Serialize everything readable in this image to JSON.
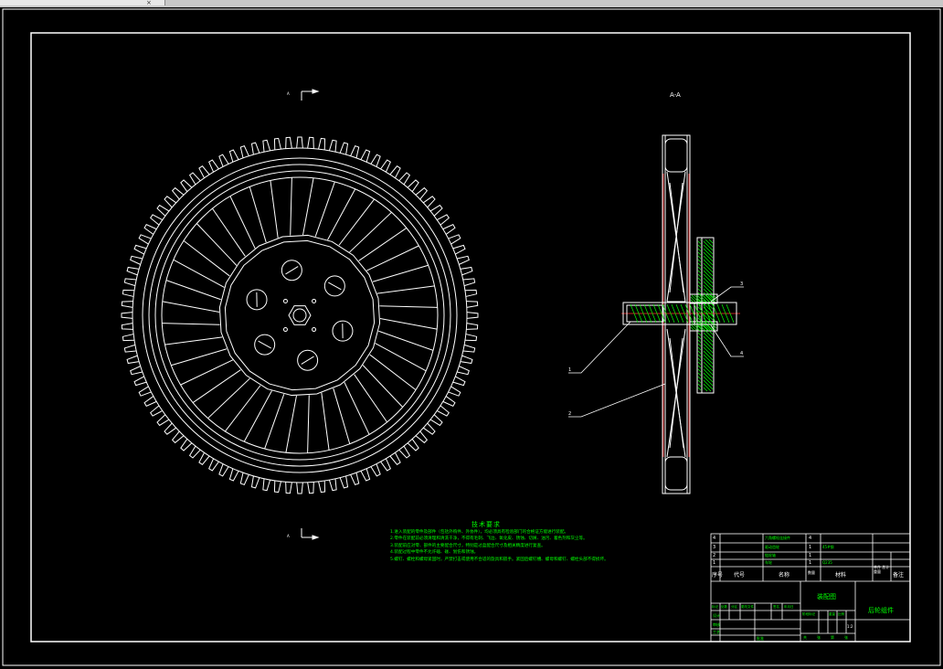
{
  "window": {
    "tab_close_glyph": "×"
  },
  "drawing": {
    "section_mark_top": "A",
    "section_mark_bottom": "A",
    "section_view_label": "A-A",
    "part_callouts": [
      "1",
      "2",
      "3",
      "4"
    ]
  },
  "notes": {
    "title": "技术要求",
    "lines": [
      "1.进入装配的零件及部件（包括外购件、外协件），均必须具有检验部门的合格证方能进行装配。",
      "2.零件在装配前必须清理和清洗干净，不得有毛刺、飞边、氧化皮、锈蚀、切屑、油污、着色剂和灰尘等。",
      "3.装配前应对零、部件的主要配合尺寸，特别是过盈配合尺寸及相关精度进行复查。",
      "4.装配过程中零件不允许磕、碰、划伤和锈蚀。",
      "5.螺钉、螺栓和螺母紧固时，严禁打击或使用不合适的旋具和扳手。紧固后螺钉槽、螺母和螺钉、螺栓头部不得损坏。"
    ]
  },
  "title_block": {
    "bom_rows": [
      {
        "no": "4",
        "name": "六角螺栓连接件",
        "qty": "4",
        "material": ""
      },
      {
        "no": "3",
        "name": "驱动齿轮",
        "qty": "1",
        "material": "45#钢"
      },
      {
        "no": "2",
        "name": "链轮轴",
        "qty": "1",
        "material": ""
      },
      {
        "no": "1",
        "name": "车轮",
        "qty": "1",
        "material": "Q235"
      }
    ],
    "bom_header": {
      "no": "序号",
      "code": "代号",
      "name": "名称",
      "qty": "数量",
      "material": "材料",
      "weight": "单件 总计 重量",
      "remark": "备注"
    },
    "drawing_name": "装配图",
    "company": "后轮组件",
    "sign_labels": [
      "标记",
      "处数",
      "分区",
      "更改文件号",
      "签名",
      "年月日"
    ],
    "role_labels": [
      "设计",
      "审核",
      "工艺",
      "批准"
    ],
    "stage_labels": [
      "阶段标记",
      "重量",
      "比例"
    ],
    "scale": "1:2",
    "sheet_labels": [
      "共",
      "张",
      "第",
      "张"
    ]
  }
}
